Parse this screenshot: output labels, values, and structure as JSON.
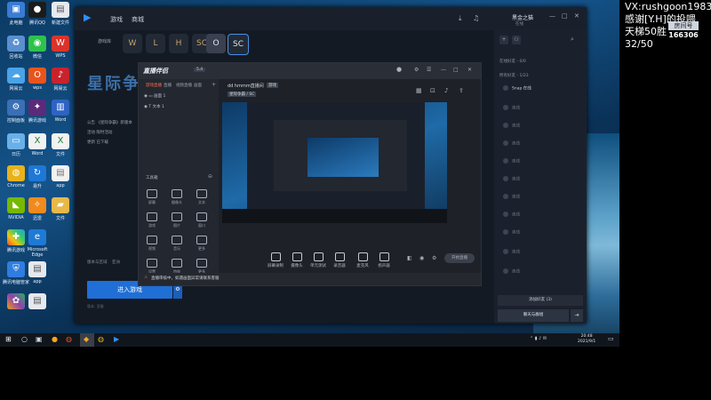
{
  "desktop": {
    "icons_left": [
      "此电脑",
      "微信",
      "网易云",
      "回收站",
      "WPS",
      "wps",
      "控制面板",
      "腾讯QQ",
      "Word",
      "Chrome",
      "易升",
      "日历",
      "NVIDIA",
      "迅雷",
      "文件",
      "腾讯游戏",
      "Microsoft Edge",
      "",
      "腾讯电脑管家",
      "app",
      "",
      "新建文件",
      "",
      ""
    ]
  },
  "launcher": {
    "nav": [
      "游戏",
      "商城"
    ],
    "games_label": "游戏库",
    "game_tabs": [
      "W",
      "L",
      "H",
      "SC",
      "O",
      "SC"
    ],
    "heading": "星际争霸",
    "news": [
      "公告 《星际争霸》新版本",
      "活动 限时活动",
      "更新 已下载"
    ],
    "region_label": "版本与区域",
    "region_value": "亚洲",
    "play_button": "进入游戏",
    "sub_label": "版本: 亚服",
    "user_name": "黑金之猫",
    "user_status": "在线",
    "friends_header": "在线好友 - 0/0",
    "group_header": "所有好友 - 1/23",
    "friends": [
      "Snap 在线",
      "离线",
      "离线",
      "离线",
      "离线",
      "离线",
      "离线",
      "离线",
      "离线",
      "离线",
      "离线"
    ],
    "add_friend": "添加好友 (3)",
    "chat_button": "聊天与群组"
  },
  "capture": {
    "app_name": "直播伴侣",
    "version": "5.4",
    "tabs": [
      "游戏直播",
      "直播",
      "视频直播",
      "画面"
    ],
    "sources": [
      "画面 1",
      "文本 1"
    ],
    "tools_header": "工具箱",
    "tools": [
      "屏幕",
      "摄像头",
      "文本",
      "游戏",
      "图片",
      "窗口",
      "视频",
      "音乐",
      "更多",
      "设置",
      "特效",
      "更多"
    ],
    "room_title": "dd hmmm直播间",
    "room_tag": "游戏",
    "room_sub": "星际争霸 / SC",
    "bottom_tools": [
      "屏幕录制",
      "摄像头",
      "单元测试",
      "录音器",
      "麦克风",
      "扬声器"
    ],
    "start_button": "开始直播",
    "notice": "直播审核中，如遇画面异常请联系客服"
  },
  "overlay": {
    "vx": "VX:rushgoon1983",
    "thanks": "感谢[Y.H]的投喂",
    "ladder": "天梯50胜",
    "count": "32/50",
    "room_label": "房间号",
    "room_number": "166306"
  },
  "taskbar": {
    "time": "20:48",
    "date": "2021/9/1"
  },
  "colors": {
    "accent": "#1f6fd6",
    "launcher_bg": "#141a24",
    "capture_bg": "#1e2128"
  }
}
